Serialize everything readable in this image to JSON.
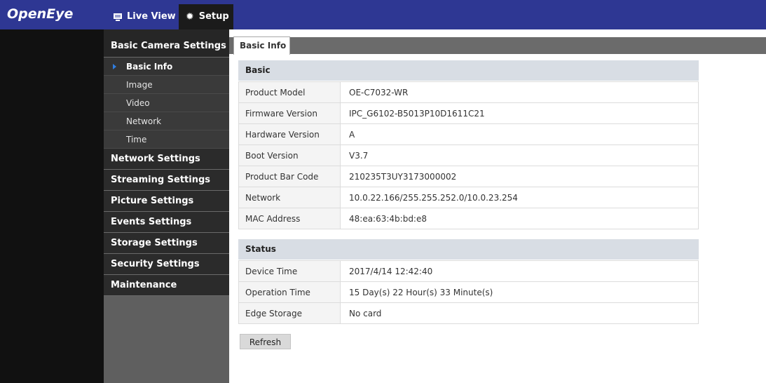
{
  "brand": {
    "logo_text": "OpenEye"
  },
  "topnav": {
    "live_view_label": "Live View",
    "setup_label": "Setup"
  },
  "sidebar": {
    "sections": [
      {
        "label": "Basic Camera Settings"
      },
      {
        "label": "Network Settings"
      },
      {
        "label": "Streaming Settings"
      },
      {
        "label": "Picture Settings"
      },
      {
        "label": "Events Settings"
      },
      {
        "label": "Storage Settings"
      },
      {
        "label": "Security Settings"
      },
      {
        "label": "Maintenance"
      }
    ],
    "sub_items": [
      {
        "label": "Basic Info",
        "active": true
      },
      {
        "label": "Image"
      },
      {
        "label": "Video"
      },
      {
        "label": "Network"
      },
      {
        "label": "Time"
      }
    ]
  },
  "main": {
    "active_tab": "Basic Info",
    "basic": {
      "title": "Basic",
      "rows": [
        {
          "label": "Product Model",
          "value": "OE-C7032-WR"
        },
        {
          "label": "Firmware Version",
          "value": "IPC_G6102-B5013P10D1611C21"
        },
        {
          "label": "Hardware Version",
          "value": "A"
        },
        {
          "label": "Boot Version",
          "value": "V3.7"
        },
        {
          "label": "Product Bar Code",
          "value": "210235T3UY3173000002"
        },
        {
          "label": "Network",
          "value": "10.0.22.166/255.255.252.0/10.0.23.254"
        },
        {
          "label": "MAC Address",
          "value": "48:ea:63:4b:bd:e8"
        }
      ]
    },
    "status": {
      "title": "Status",
      "rows": [
        {
          "label": "Device Time",
          "value": "2017/4/14 12:42:40"
        },
        {
          "label": "Operation Time",
          "value": "15 Day(s) 22 Hour(s) 33 Minute(s)"
        },
        {
          "label": "Edge Storage",
          "value": "No card"
        }
      ]
    },
    "refresh_label": "Refresh"
  },
  "colors": {
    "topbar": "#2e3793",
    "sidebar_section": "#2b2b2b",
    "sidebar_sub": "#3a3a3a",
    "section_header": "#d8dde4",
    "active_caret": "#2f7de0"
  }
}
